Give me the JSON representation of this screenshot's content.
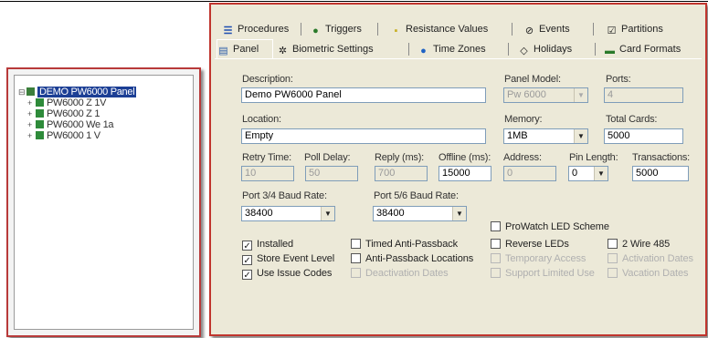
{
  "tree": {
    "root_label": "DEMO PW6000 Panel",
    "children": [
      "PW6000 Z 1V",
      "PW6000 Z 1",
      "PW6000 We 1a",
      "PW6000 1 V"
    ]
  },
  "dialog": {
    "tabs_back": [
      {
        "label": "Procedures",
        "icon": "procedures-icon"
      },
      {
        "label": "Triggers",
        "icon": "triggers-icon"
      },
      {
        "label": "Resistance Values",
        "icon": "resistance-icon"
      },
      {
        "label": "Events",
        "icon": "events-icon"
      },
      {
        "label": "Partitions",
        "icon": "partitions-icon"
      }
    ],
    "tabs_front": [
      {
        "label": "Panel",
        "icon": "panel-icon"
      },
      {
        "label": "Biometric Settings",
        "icon": "biometric-icon"
      },
      {
        "label": "Time Zones",
        "icon": "globe-icon"
      },
      {
        "label": "Holidays",
        "icon": "holidays-icon"
      },
      {
        "label": "Card Formats",
        "icon": "card-icon"
      }
    ],
    "description_label": "Description:",
    "description_value": "Demo PW6000 Panel",
    "panel_model_label": "Panel Model:",
    "panel_model_value": "Pw 6000",
    "ports_label": "Ports:",
    "ports_value": "4",
    "location_label": "Location:",
    "location_value": "Empty",
    "memory_label": "Memory:",
    "memory_value": "1MB",
    "total_cards_label": "Total Cards:",
    "total_cards_value": "5000",
    "retry_label": "Retry Time:",
    "retry_value": "10",
    "poll_label": "Poll Delay:",
    "poll_value": "50",
    "reply_label": "Reply (ms):",
    "reply_value": "700",
    "offline_label": "Offline (ms):",
    "offline_value": "15000",
    "address_label": "Address:",
    "address_value": "0",
    "pin_label": "Pin Length:",
    "pin_value": "0",
    "transactions_label": "Transactions:",
    "transactions_value": "5000",
    "port34_label": "Port 3/4 Baud Rate:",
    "port34_value": "38400",
    "port56_label": "Port 5/6 Baud Rate:",
    "port56_value": "38400",
    "checkboxes": {
      "prowatch_led": {
        "label": "ProWatch LED Scheme",
        "checked": false
      },
      "installed": {
        "label": "Installed",
        "checked": true
      },
      "timed_apb": {
        "label": "Timed Anti-Passback",
        "checked": false
      },
      "reverse_leds": {
        "label": "Reverse LEDs",
        "checked": false
      },
      "two_wire": {
        "label": "2 Wire 485",
        "checked": false
      },
      "store_event": {
        "label": "Store Event Level",
        "checked": true
      },
      "apb_locations": {
        "label": "Anti-Passback Locations",
        "checked": false
      },
      "temp_access": {
        "label": "Temporary Access",
        "checked": false
      },
      "activation": {
        "label": "Activation Dates",
        "checked": false
      },
      "use_issue": {
        "label": "Use Issue Codes",
        "checked": true
      },
      "deactivation": {
        "label": "Deactivation Dates",
        "checked": false
      },
      "support_limited": {
        "label": "Support Limited Use",
        "checked": false
      },
      "vacation": {
        "label": "Vacation Dates",
        "checked": false
      }
    }
  }
}
